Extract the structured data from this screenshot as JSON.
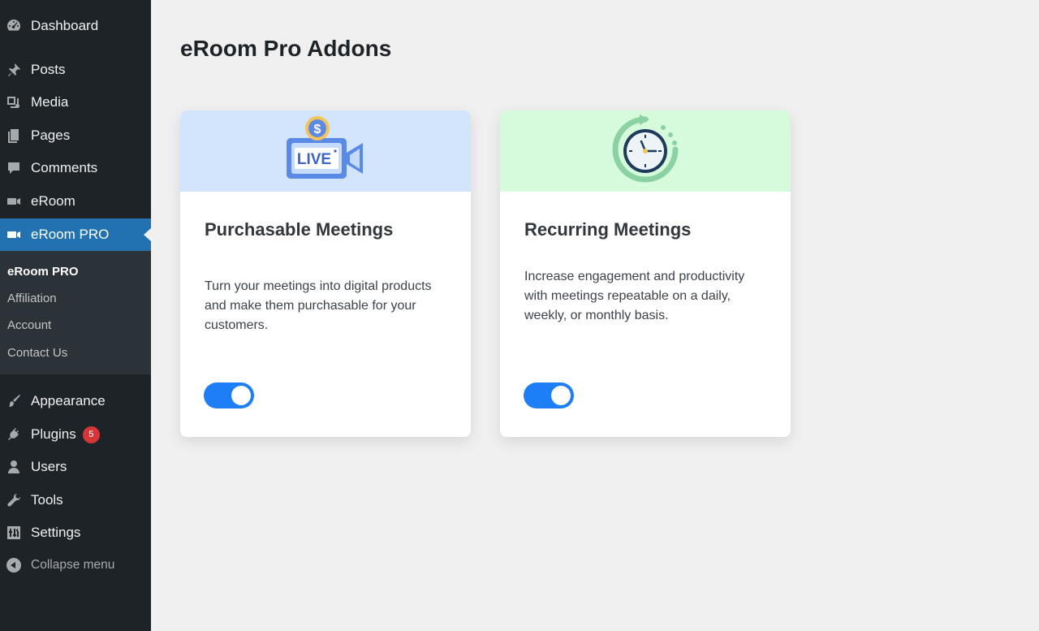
{
  "sidebar": {
    "items": [
      {
        "label": "Dashboard",
        "icon": "dashboard-icon"
      },
      {
        "label": "Posts",
        "icon": "pushpin-icon"
      },
      {
        "label": "Media",
        "icon": "media-icon"
      },
      {
        "label": "Pages",
        "icon": "pages-icon"
      },
      {
        "label": "Comments",
        "icon": "comment-icon"
      },
      {
        "label": "eRoom",
        "icon": "video-camera-icon"
      },
      {
        "label": "eRoom PRO",
        "icon": "video-camera-icon",
        "active": true
      },
      {
        "label": "Appearance",
        "icon": "paintbrush-icon"
      },
      {
        "label": "Plugins",
        "icon": "plugin-icon",
        "badge": "5"
      },
      {
        "label": "Users",
        "icon": "user-icon"
      },
      {
        "label": "Tools",
        "icon": "wrench-icon"
      },
      {
        "label": "Settings",
        "icon": "settings-sliders-icon"
      },
      {
        "label": "Collapse menu",
        "icon": "collapse-arrow-icon"
      }
    ],
    "submenu": [
      {
        "label": "eRoom PRO",
        "current": true
      },
      {
        "label": "Affiliation"
      },
      {
        "label": "Account"
      },
      {
        "label": "Contact Us"
      }
    ]
  },
  "page": {
    "title": "eRoom Pro Addons"
  },
  "cards": [
    {
      "title": "Purchasable Meetings",
      "description": "Turn your meetings into digital products and make them purchasable for your customers.",
      "icon": "live-video-dollar-icon",
      "icon_text": "LIVE",
      "icon_symbol": "$",
      "header_color": "#d3e5fd",
      "enabled": true
    },
    {
      "title": "Recurring Meetings",
      "description": "Increase engagement and productivity with meetings repeatable on a daily, weekly, or monthly basis.",
      "icon": "recurring-clock-icon",
      "header_color": "#d6fbdc",
      "enabled": true
    }
  ],
  "colors": {
    "sidebar_bg": "#1d2327",
    "active_bg": "#2271b1",
    "toggle_on": "#1e7ef5",
    "badge": "#d63638"
  }
}
